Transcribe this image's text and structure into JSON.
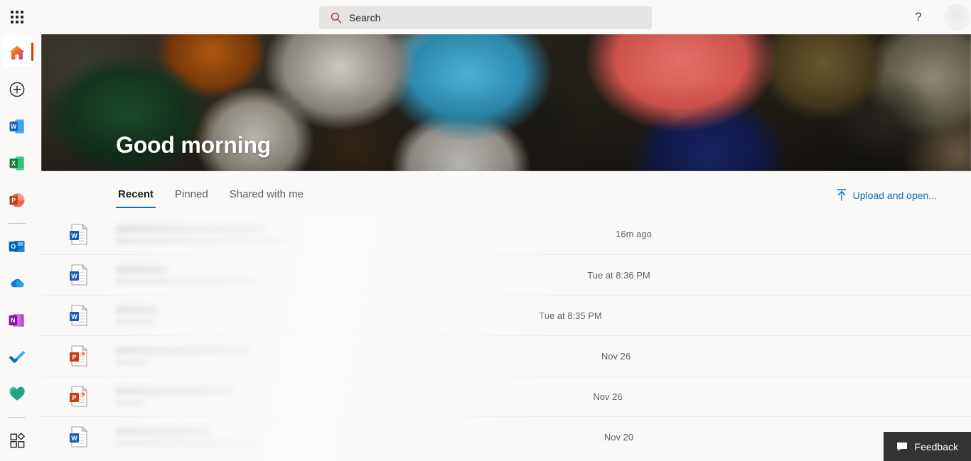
{
  "header": {
    "waffle_label": "App launcher",
    "search": {
      "placeholder": "Search",
      "value": "",
      "icon": "search-icon"
    },
    "help_glyph": "?",
    "help_label": "Help",
    "avatar_label": "Account manager"
  },
  "rail": {
    "items": [
      {
        "name": "home",
        "label": "Home",
        "icon": "home-icon",
        "selected": true
      },
      {
        "name": "create",
        "label": "Create",
        "icon": "plus-circle-icon",
        "selected": false
      },
      {
        "name": "word",
        "label": "Word",
        "icon": "word-icon",
        "selected": false
      },
      {
        "name": "excel",
        "label": "Excel",
        "icon": "excel-icon",
        "selected": false
      },
      {
        "name": "powerpoint",
        "label": "PowerPoint",
        "icon": "powerpoint-icon",
        "selected": false
      },
      {
        "name": "outlook",
        "label": "Outlook",
        "icon": "outlook-icon",
        "selected": false
      },
      {
        "name": "onedrive",
        "label": "OneDrive",
        "icon": "onedrive-icon",
        "selected": false
      },
      {
        "name": "onenote",
        "label": "OneNote",
        "icon": "onenote-icon",
        "selected": false
      },
      {
        "name": "todo",
        "label": "To Do",
        "icon": "checkmark-icon",
        "selected": false
      },
      {
        "name": "family",
        "label": "Family Safety",
        "icon": "heart-icon",
        "selected": false
      },
      {
        "name": "apps",
        "label": "Apps",
        "icon": "apps-icon",
        "selected": false
      }
    ]
  },
  "hero": {
    "greeting": "Good morning",
    "image_description": "open paint cans photo"
  },
  "main": {
    "tabs": [
      {
        "label": "Recent",
        "active": true
      },
      {
        "label": "Pinned",
        "active": false
      },
      {
        "label": "Shared with me",
        "active": false
      }
    ],
    "upload": {
      "label": "Upload and open...",
      "icon": "upload-icon"
    },
    "files": [
      {
        "type": "word",
        "icon": "word-doc-icon",
        "name_redacted": true,
        "subtitle_redacted": true,
        "time": "16m ago"
      },
      {
        "type": "word",
        "icon": "word-doc-icon",
        "name_redacted": true,
        "subtitle_redacted": true,
        "time": "Tue at 8:36 PM"
      },
      {
        "type": "word",
        "icon": "word-doc-icon",
        "name_redacted": true,
        "subtitle_redacted": true,
        "time": "Tue at 8:35 PM"
      },
      {
        "type": "powerpoint",
        "icon": "powerpoint-doc-icon",
        "name_redacted": true,
        "subtitle_redacted": true,
        "time": "Nov 26"
      },
      {
        "type": "powerpoint",
        "icon": "powerpoint-doc-icon",
        "name_redacted": true,
        "subtitle_redacted": true,
        "time": "Nov 26"
      },
      {
        "type": "word",
        "icon": "word-doc-icon",
        "name_redacted": true,
        "subtitle_redacted": true,
        "time": "Nov 20"
      }
    ]
  },
  "feedback": {
    "label": "Feedback",
    "icon": "speech-bubble-icon"
  },
  "colors": {
    "page_bg": "#faf9f8",
    "search_bg": "#e6e4e2",
    "accent_blue": "#0f6cbd",
    "selected_indicator": "#d83b01",
    "feedback_bg": "#333333",
    "divider": "#edebe9",
    "secondary_text": "#605e5c"
  }
}
